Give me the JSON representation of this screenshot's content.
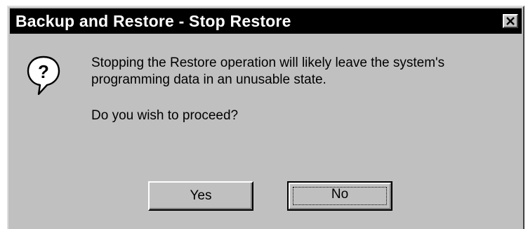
{
  "window": {
    "title": "Backup and Restore - Stop Restore"
  },
  "icons": {
    "close": "close-icon",
    "question": "question-icon"
  },
  "message": {
    "line1": "Stopping the Restore operation will likely leave the system's",
    "line2": "programming data in an unusable state.",
    "prompt": "Do you wish to proceed?"
  },
  "buttons": {
    "yes_label": "Yes",
    "no_label": "No",
    "default": "No"
  },
  "colors": {
    "dialog_face": "#c0c0c0",
    "titlebar": "#000000",
    "title_text": "#ffffff"
  }
}
